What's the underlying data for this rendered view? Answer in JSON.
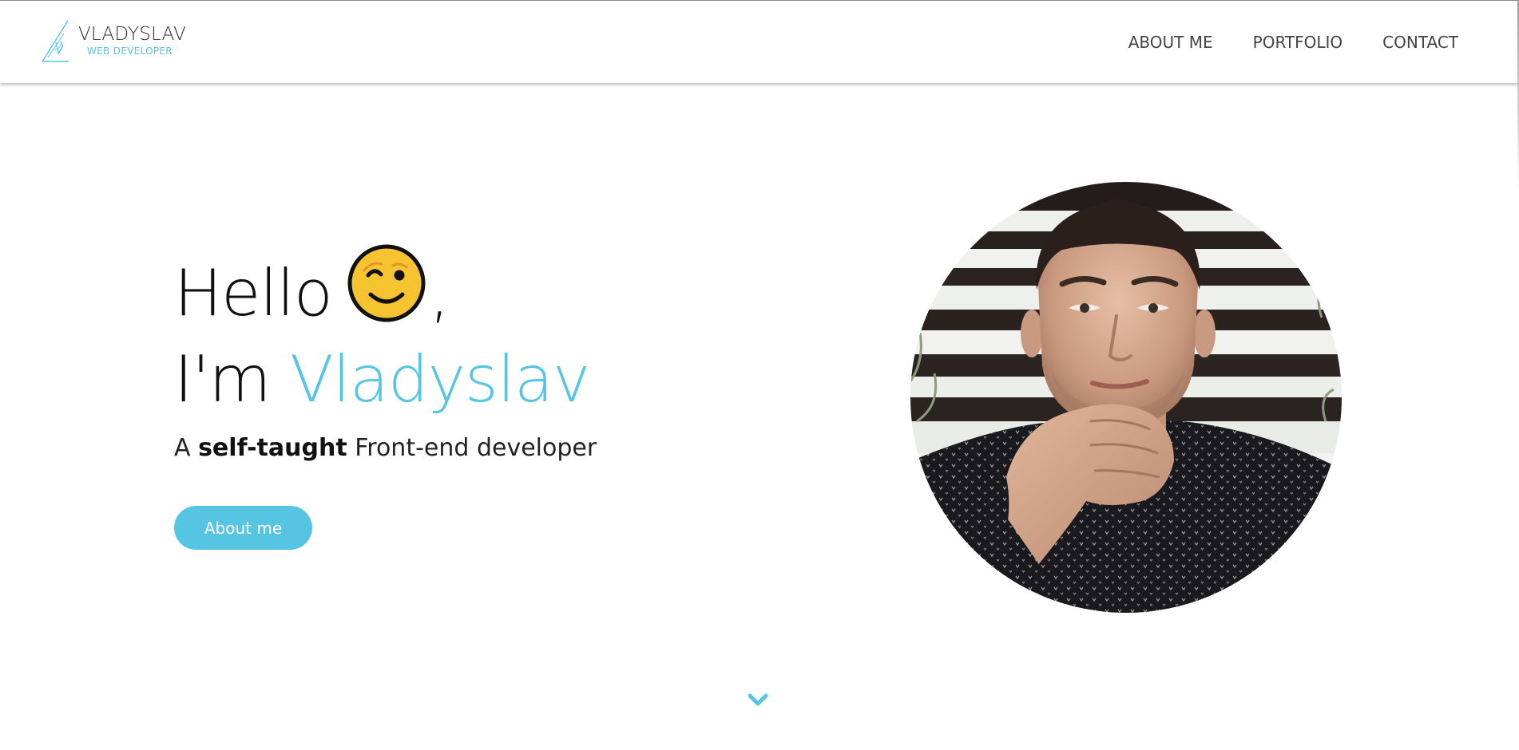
{
  "header": {
    "logo": {
      "name": "VLADYSLAV",
      "subtitle": "WEB DEVELOPER"
    },
    "nav": [
      {
        "label": "ABOUT ME"
      },
      {
        "label": "PORTFOLIO"
      },
      {
        "label": "CONTACT"
      }
    ]
  },
  "hero": {
    "greeting": "Hello",
    "greeting_emoji": "winking-face-icon",
    "greeting_punct": ",",
    "intro": "I'm",
    "name": "Vladyslav",
    "tagline_prefix": "A",
    "tagline_bold": "self-taught",
    "tagline_suffix": "Front-end developer",
    "button_label": "About me",
    "photo": "portrait photo of Vladyslav"
  },
  "scroll": {
    "icon": "chevron-down-icon"
  },
  "colors": {
    "accent": "#56c5e3",
    "text": "#111111",
    "nav_text": "#444444",
    "background": "#ffffff"
  }
}
